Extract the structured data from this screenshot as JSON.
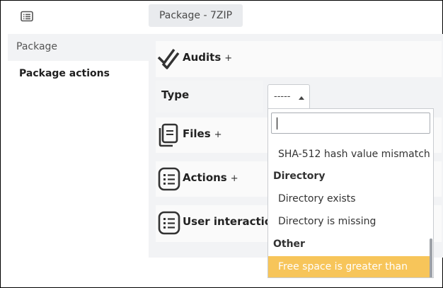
{
  "header": {
    "title_tab": "Package - 7ZIP"
  },
  "nav": {
    "items": [
      {
        "label": "Package"
      },
      {
        "label": "Package actions"
      }
    ]
  },
  "sections": {
    "audits": {
      "label": "Audits",
      "plus": "+"
    },
    "type": {
      "label": "Type",
      "select_value": "-----"
    },
    "files": {
      "label": "Files",
      "plus": "+"
    },
    "actions": {
      "label": "Actions",
      "plus": "+"
    },
    "user_interaction": {
      "label": "User interaction"
    }
  },
  "dropdown": {
    "search_value": "",
    "options": [
      {
        "kind": "option",
        "label": "SHA-512 hash value mismatch"
      },
      {
        "kind": "group",
        "label": "Directory"
      },
      {
        "kind": "option",
        "label": "Directory exists"
      },
      {
        "kind": "option",
        "label": "Directory is missing"
      },
      {
        "kind": "group",
        "label": "Other"
      },
      {
        "kind": "option",
        "label": "Free space is greater than",
        "highlighted": true
      }
    ]
  },
  "colors": {
    "highlight": "#f7c55a",
    "panel": "#f2f3f5"
  },
  "icons": [
    "list-icon",
    "checkmarks-icon",
    "files-icon",
    "actions-list-icon",
    "user-interaction-icon",
    "caret-up-icon"
  ]
}
